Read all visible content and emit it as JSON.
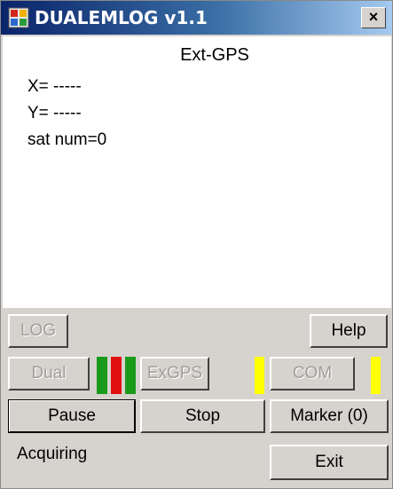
{
  "window": {
    "title": "DUALEMLOG v1.1",
    "close_label": "×"
  },
  "display": {
    "title": "Ext-GPS",
    "x_readout": "X= -----",
    "y_readout": "Y= -----",
    "sat_readout": "sat num=0"
  },
  "buttons": {
    "log": "LOG",
    "help": "Help",
    "dual": "Dual",
    "exgps": "ExGPS",
    "com": "COM",
    "pause": "Pause",
    "stop": "Stop",
    "marker": "Marker (0)",
    "exit": "Exit"
  },
  "indicators": {
    "dual_colors": [
      "#1a9a1a",
      "#e01010",
      "#1a9a1a"
    ],
    "exgps_color": "#ffff00",
    "com_color": "#ffff00"
  },
  "status": {
    "text": "Acquiring"
  }
}
